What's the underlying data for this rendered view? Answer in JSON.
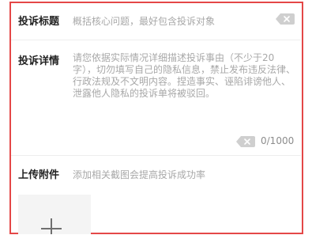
{
  "form": {
    "title_field": {
      "label": "投诉标题",
      "placeholder": "概括核心问题，最好包含投诉对象"
    },
    "details_field": {
      "label": "投诉详情",
      "placeholder": "请您依据实际情况详细描述投诉事由（不少于20字），切勿填写自己的隐私信息，禁止发布违反法律、行政法规及不文明内容。捏造事实、诬陷诽谤他人、泄露他人隐私的投诉单将被驳回。",
      "counter": "0/1000"
    },
    "attachment_field": {
      "label": "上传附件",
      "hint": "添加相关截图会提高投诉成功率"
    }
  },
  "colors": {
    "frame_border": "#e44747",
    "label": "#222222",
    "placeholder": "#a8a8a8",
    "clear_icon": "#cfcfcf"
  },
  "icons": {
    "clear": "backspace-clear-icon",
    "upload": "plus-icon"
  }
}
